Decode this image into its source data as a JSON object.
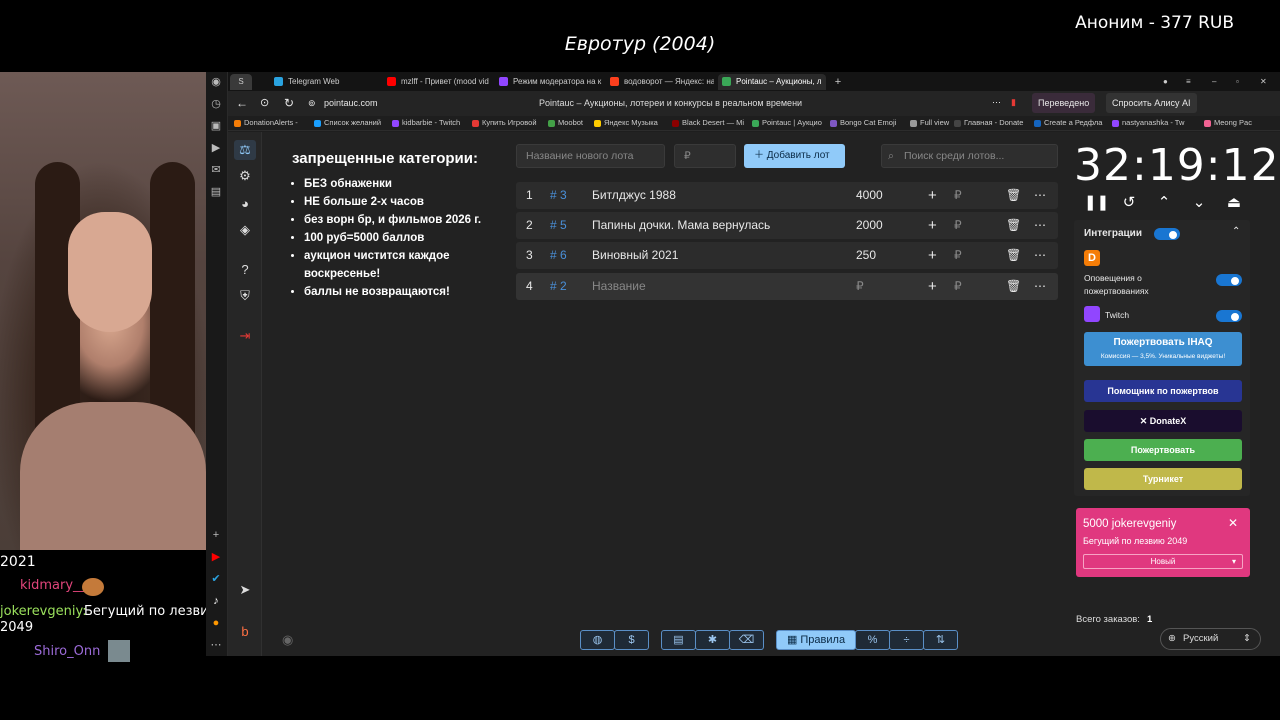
{
  "overlay": {
    "stream_title": "Евротур (2004)",
    "top_donation": "Аноним - 377 RUB"
  },
  "chat": {
    "lines": [
      {
        "user": "",
        "text": "2021"
      },
      {
        "user": "kidmary__",
        "text": ""
      },
      {
        "user": "jokerevgeniy",
        "text": "Бегущий по лезвию 2049"
      },
      {
        "user": "Shiro_Onn",
        "text": ""
      }
    ]
  },
  "browser": {
    "tabs": [
      {
        "label": "Telegram Web",
        "color": "#2aa3e0"
      },
      {
        "label": "mzlff - Привет (mood vid",
        "color": "#ff0000"
      },
      {
        "label": "Режим модератора на к",
        "color": "#9146ff"
      },
      {
        "label": "водоворот — Яндекс: наш",
        "color": "#fc3f1d"
      },
      {
        "label": "Pointauc – Аукционы, л",
        "color": "#3aa757"
      }
    ],
    "address": "pointauc.com",
    "page_title": "Pointauc – Аукционы, лотереи и конкурсы в реальном времени",
    "translated_label": "Переведено",
    "alice_label": "Спросить Алису AI",
    "bookmarks": [
      {
        "label": "DonationAlerts -",
        "color": "#f57d07"
      },
      {
        "label": "Список желаний",
        "color": "#1a9fff"
      },
      {
        "label": "kidbarbie - Twitch",
        "color": "#9146ff"
      },
      {
        "label": "Купить Игровой",
        "color": "#e53935"
      },
      {
        "label": "Moobot",
        "color": "#43a047"
      },
      {
        "label": "Яндекс Музыка",
        "color": "#ffcc00"
      },
      {
        "label": "Black Desert — Mi",
        "color": "#8b0000"
      },
      {
        "label": "Pointauc | Аукцио",
        "color": "#3aa757"
      },
      {
        "label": "Bongo Cat Emoji",
        "color": "#7e57c2"
      },
      {
        "label": "Full view",
        "color": "#999999"
      },
      {
        "label": "Главная - Donate",
        "color": "#444444"
      },
      {
        "label": "Create a Редфла",
        "color": "#1565c0"
      },
      {
        "label": "nastyanashka - Tw",
        "color": "#9146ff"
      },
      {
        "label": "Meong Pac",
        "color": "#f06292"
      }
    ]
  },
  "rules": {
    "heading": "запрещенные категории:",
    "items": [
      "БЕЗ обнаженки",
      "НЕ больше 2-х часов",
      "без ворн бр, и фильмов 2026 г.",
      "100 руб=5000 баллов",
      "аукцион чистится каждое воскресенье!",
      "баллы не возвращаются!"
    ]
  },
  "lot_form": {
    "name_placeholder": "Название нового лота",
    "amount_placeholder": "₽",
    "add_label": "Добавить лот",
    "search_placeholder": "Поиск среди лотов..."
  },
  "lots": [
    {
      "index": "1",
      "id": "# 3",
      "name": "Битлджус 1988",
      "amount": "4000",
      "currency": "₽"
    },
    {
      "index": "2",
      "id": "# 5",
      "name": "Папины дочки. Мама вернулась",
      "amount": "2000",
      "currency": "₽"
    },
    {
      "index": "3",
      "id": "# 6",
      "name": "Виновный 2021",
      "amount": "250",
      "currency": "₽"
    },
    {
      "index": "4",
      "id": "# 2",
      "name": "Название",
      "amount": "₽",
      "currency": "₽"
    }
  ],
  "timer": {
    "value": "32:19:12"
  },
  "integrations": {
    "title": "Интеграции",
    "donation_alerts_label": "Оповещения о пожертвованиях",
    "twitch_label": "Twitch",
    "donate_ihaq": "Пожертвовать IHAQ",
    "donate_ihaq_sub": "Комиссия — 3,5%. Уникальные виджеты!",
    "helper": "Помощник по пожертвов",
    "donatex": "DonateX",
    "donate": "Пожертвовать",
    "turniket": "Турникет",
    "colors": {
      "ihaq": "#3d8fd1",
      "helper": "#283593",
      "donatex": "#1a0d2e",
      "donate": "#4caf50",
      "turniket": "#c0b84a"
    }
  },
  "donation_card": {
    "title": "5000 jokerevgeniy",
    "message": "Бегущий по лезвию 2049",
    "status": "Новый",
    "color": "#e0387f"
  },
  "footer": {
    "orders_label": "Всего заказов:",
    "orders_count": "1",
    "rules_label": "Правила",
    "language": "Русский"
  }
}
